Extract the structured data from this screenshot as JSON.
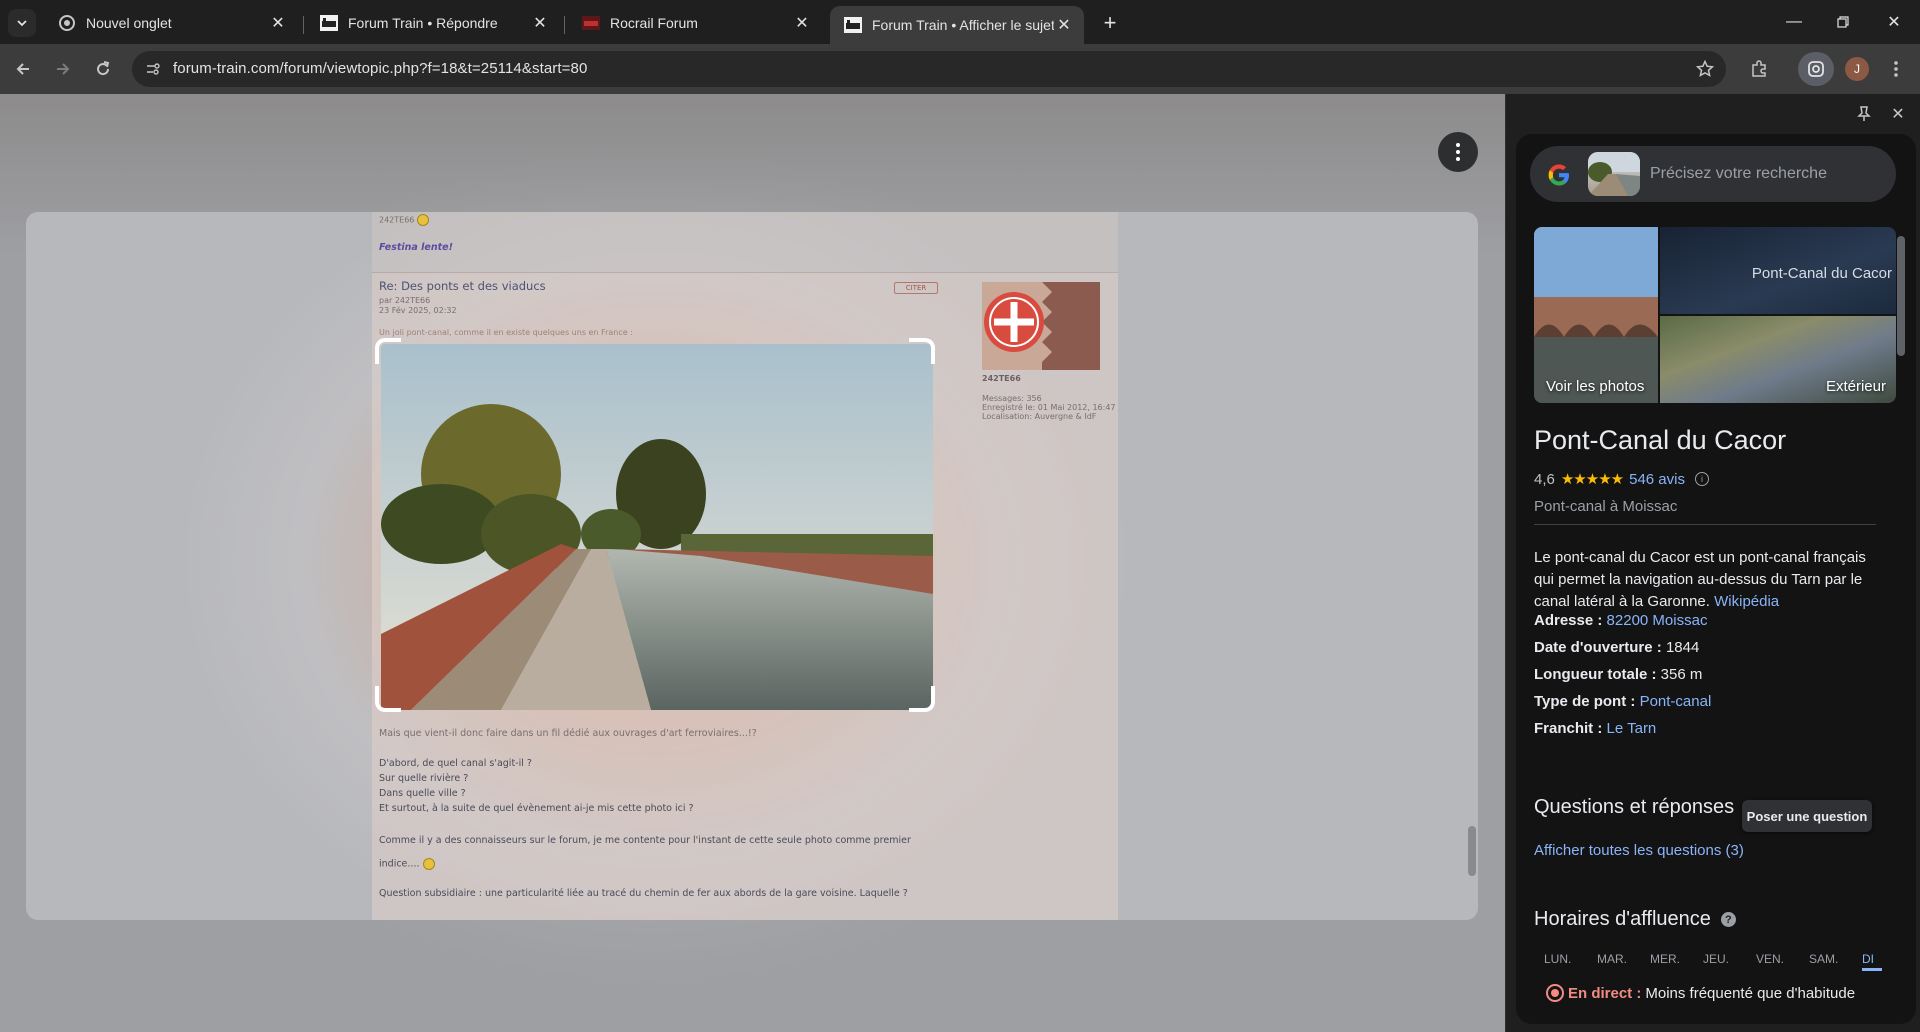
{
  "tabs": [
    {
      "title": "Nouvel onglet",
      "active": false
    },
    {
      "title": "Forum Train • Répondre",
      "active": false
    },
    {
      "title": "Rocrail Forum",
      "active": false
    },
    {
      "title": "Forum Train • Afficher le sujet -",
      "active": true
    }
  ],
  "toolbar": {
    "url": "forum-train.com/forum/viewtopic.php?f=18&t=25114&start=80",
    "profile_initial": "J"
  },
  "forum": {
    "prev_user": "242TE66",
    "signature": "Festina lente!",
    "post_title": "Re: Des ponts et des viaducs",
    "post_author": "par 242TE66",
    "post_date": "23 Fév 2025, 02:32",
    "quote_label": "CITER",
    "intro_text": "Un joli pont-canal, comme il en existe quelques uns en France :",
    "author_name": "242TE66",
    "author_messages": "Messages: 356",
    "author_registered": "Enregistré le: 01 Mai 2012, 16:47",
    "author_location": "Localisation: Auvergne & IdF",
    "body_lines": [
      "Mais que vient-il donc faire dans un fil dédié aux ouvrages d'art ferroviaires...!?",
      "D'abord, de quel canal s'agit-il ?",
      "Sur quelle rivière ?",
      "Dans quelle ville ?",
      "Et surtout, à la suite de quel évènement ai-je mis cette photo ici ?",
      "Comme il y a des connaisseurs sur le forum, je me contente pour l'instant de cette seule photo comme premier",
      "indice....",
      "Question subsidiaire : une particularité liée au tracé du chemin de fer aux abords de la gare voisine. Laquelle ?"
    ]
  },
  "lens": {
    "search_placeholder": "Précisez votre recherche",
    "photos_label": "Voir les photos",
    "photo_overlay_title": "Pont-Canal du Cacor",
    "exterior_label": "Extérieur",
    "place_title": "Pont-Canal du Cacor",
    "rating": "4,6",
    "stars": "★★★★★",
    "reviews": "546 avis",
    "subtitle": "Pont-canal à Moissac",
    "description": "Le pont-canal du Cacor est un pont-canal français qui permet la navigation au-dessus du Tarn par le canal latéral à la Garonne.",
    "description_link": "Wikipédia",
    "facts": [
      {
        "label": "Adresse :",
        "value": "82200 Moissac",
        "link": true
      },
      {
        "label": "Date d'ouverture :",
        "value": "1844",
        "link": false
      },
      {
        "label": "Longueur totale :",
        "value": "356 m",
        "link": false
      },
      {
        "label": "Type de pont :",
        "value": "Pont-canal",
        "link": true
      },
      {
        "label": "Franchit :",
        "value": "Le Tarn",
        "link": true
      }
    ],
    "qa_title": "Questions et réponses",
    "ask_button": "Poser une question",
    "qa_link": "Afficher toutes les questions (3)",
    "busy_title": "Horaires d'affluence",
    "days": [
      "LUN.",
      "MAR.",
      "MER.",
      "JEU.",
      "VEN.",
      "SAM.",
      "DI"
    ],
    "live_label": "En direct :",
    "live_text": "Moins fréquenté que d'habitude"
  },
  "colors": {
    "accent_link": "#8ab4f8",
    "star": "#fbbc04",
    "live": "#f28b82"
  }
}
